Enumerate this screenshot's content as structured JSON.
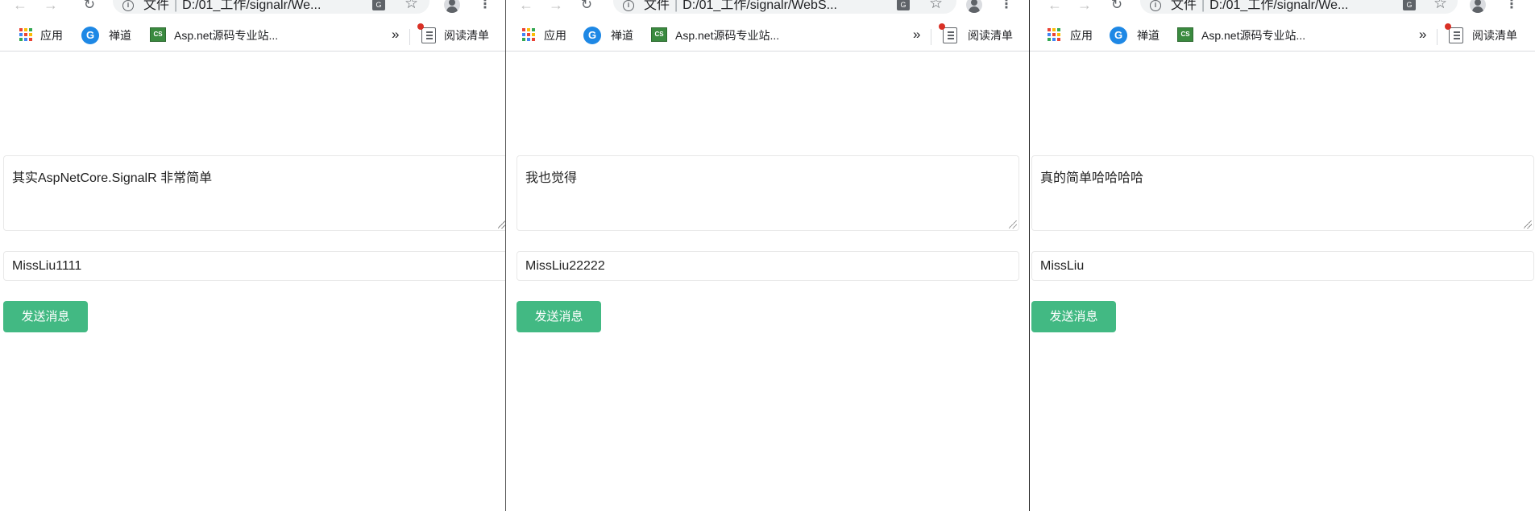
{
  "windows": [
    {
      "url": "D:/01_工作/signalr/We...",
      "url_scheme_label": "文件",
      "bookmarks": {
        "apps": "应用",
        "chandao": "禅道",
        "aspnet": "Asp.net源码专业站...",
        "more": "»",
        "reading_list": "阅读清单"
      },
      "message_value": "其实AspNetCore.SignalR 非常简单",
      "username_value": "MissLiu1111",
      "send_label": "发送消息"
    },
    {
      "url": "D:/01_工作/signalr/WebS...",
      "url_scheme_label": "文件",
      "bookmarks": {
        "apps": "应用",
        "chandao": "禅道",
        "aspnet": "Asp.net源码专业站...",
        "more": "»",
        "reading_list": "阅读清单"
      },
      "message_value": "我也觉得",
      "username_value": "MissLiu22222",
      "send_label": "发送消息"
    },
    {
      "url": "D:/01_工作/signalr/We...",
      "url_scheme_label": "文件",
      "bookmarks": {
        "apps": "应用",
        "chandao": "禅道",
        "aspnet": "Asp.net源码专业站...",
        "more": "»",
        "reading_list": "阅读清单"
      },
      "message_value": "真的简单哈哈哈哈",
      "username_value": "MissLiu",
      "send_label": "发送消息"
    }
  ],
  "colors": {
    "send_button": "#42b983",
    "apps_grid": [
      "#ea4335",
      "#fbbc05",
      "#34a853",
      "#4285f4",
      "#ea4335",
      "#fbbc05",
      "#34a853",
      "#4285f4",
      "#ea4335"
    ]
  },
  "icons": {
    "back": "back-arrow-icon",
    "forward": "forward-arrow-icon",
    "reload": "reload-icon",
    "info": "info-icon",
    "translate": "translate-icon",
    "bookmark_star": "star-icon",
    "profile": "profile-icon",
    "menu": "kebab-menu-icon",
    "apps": "apps-grid-icon",
    "chandao": "chandao-icon",
    "aspnet": "aspnet-favicon",
    "reading_list": "reading-list-icon"
  }
}
